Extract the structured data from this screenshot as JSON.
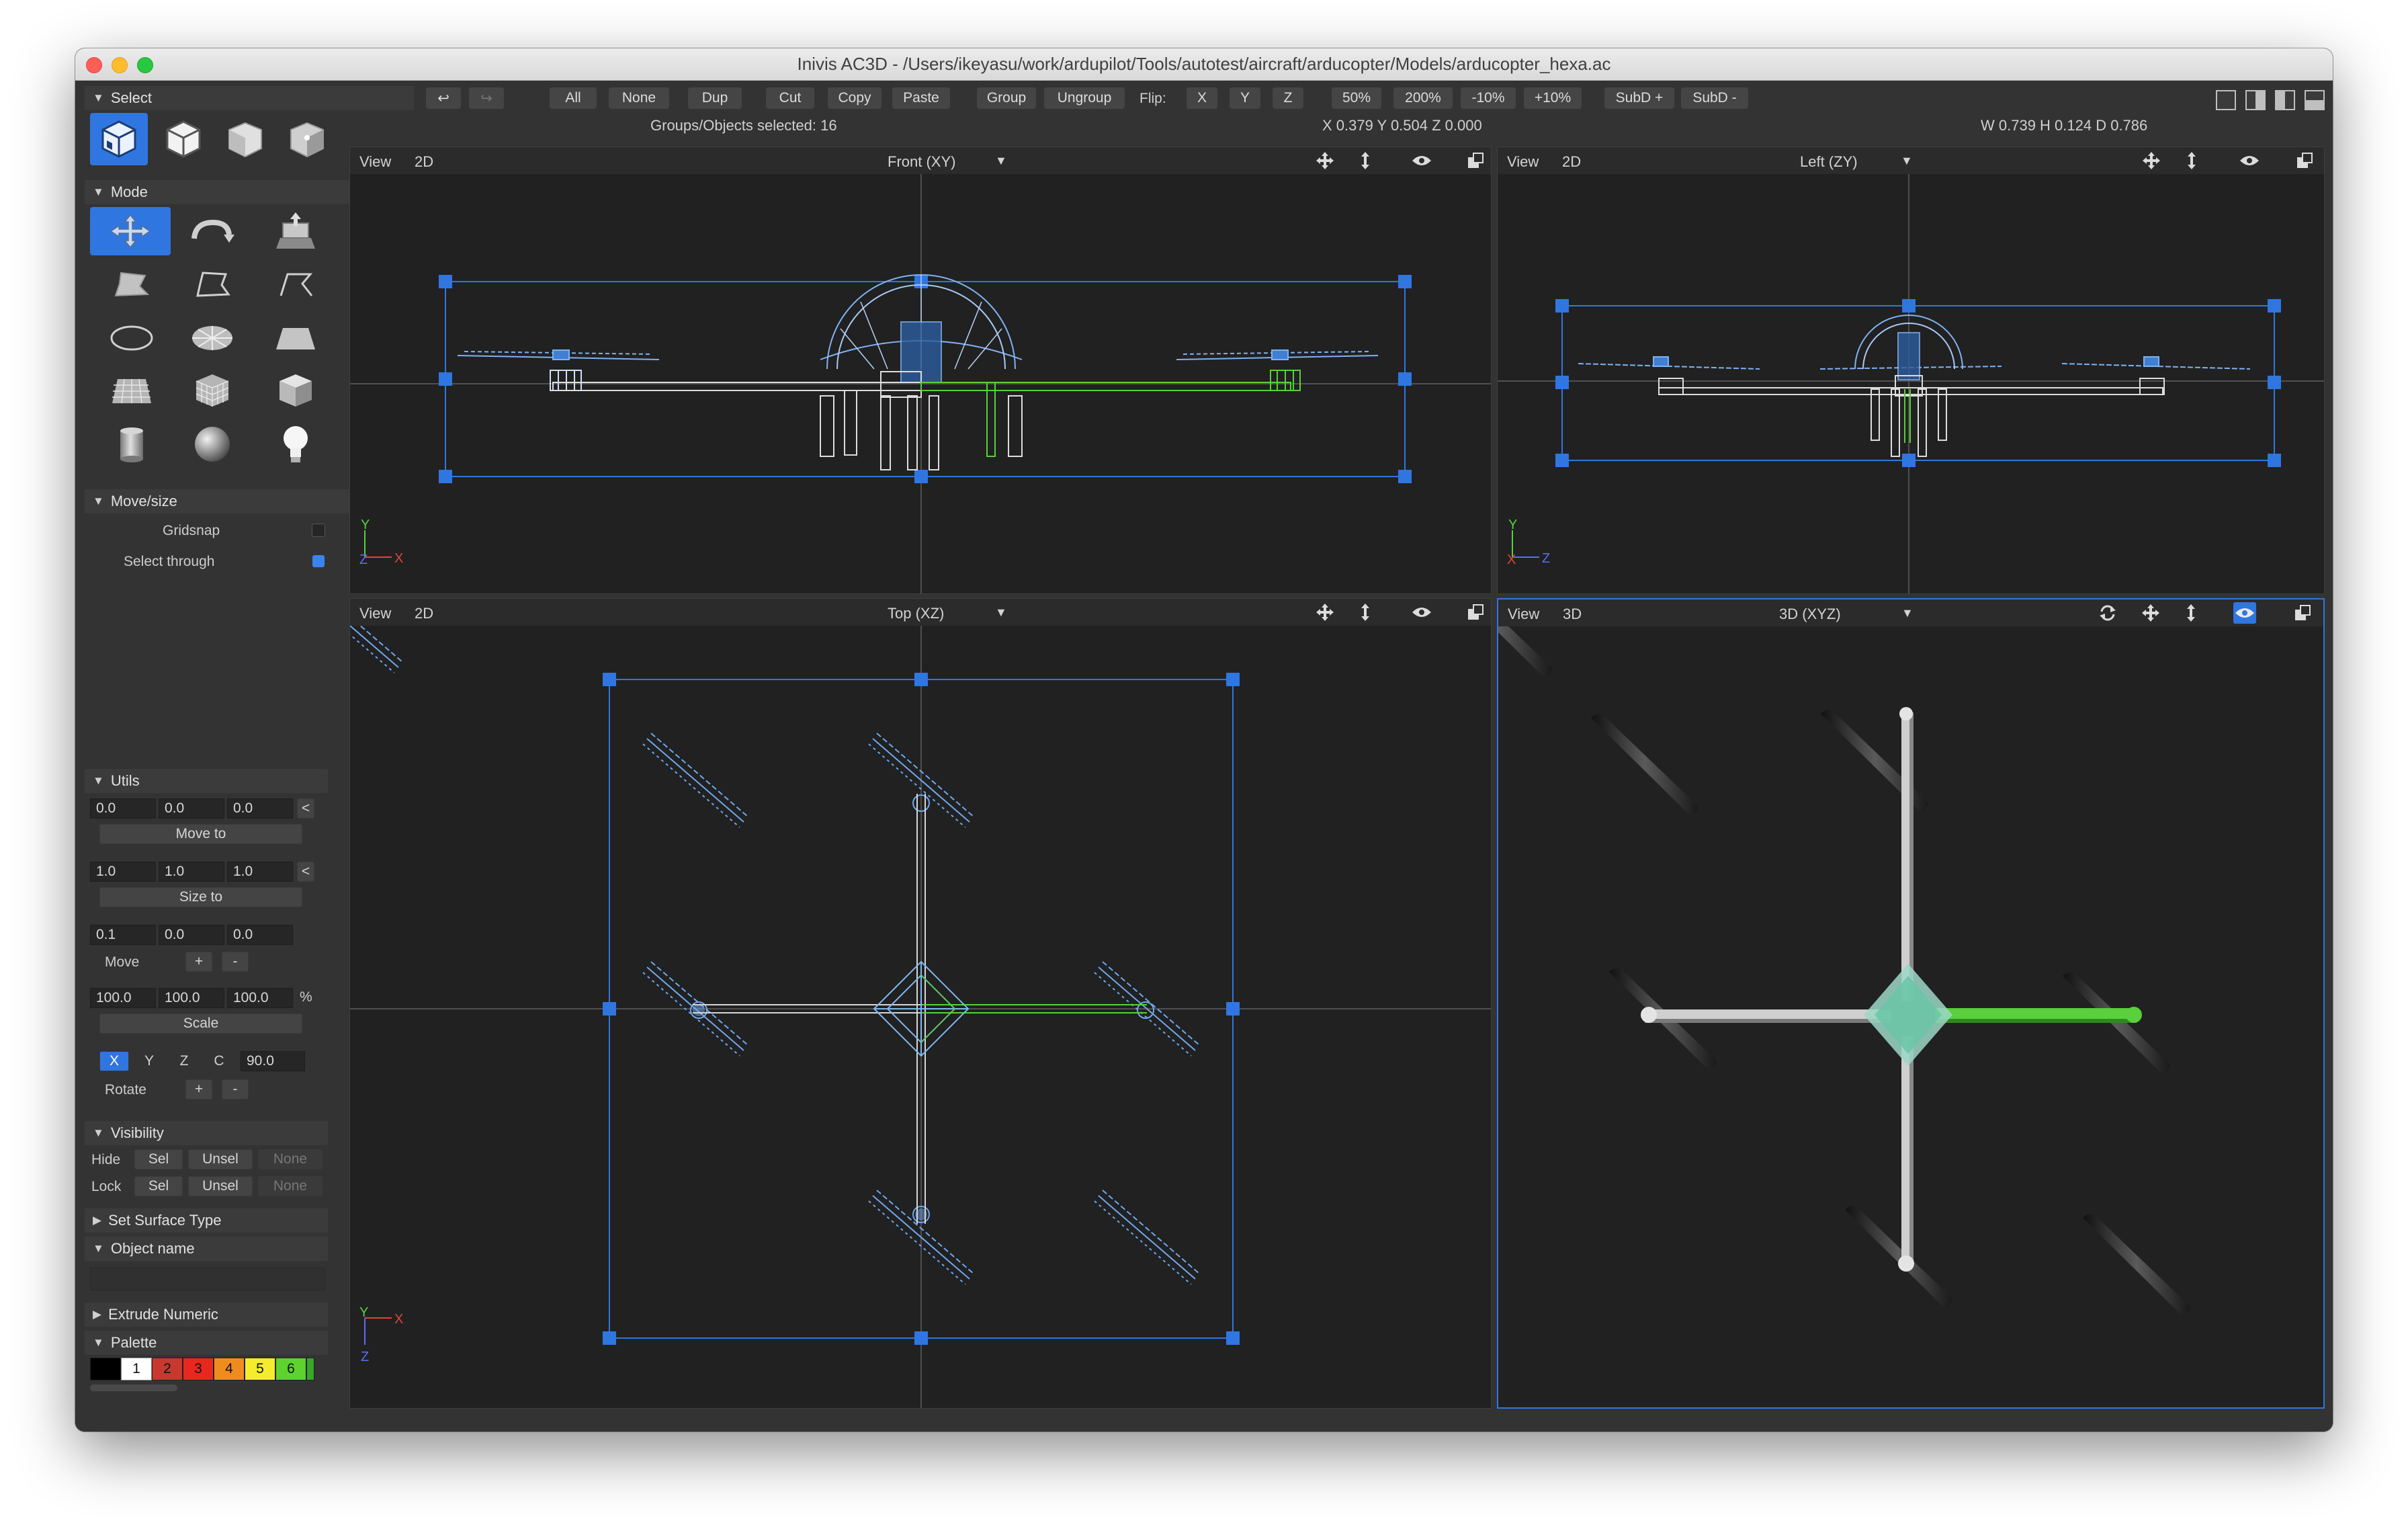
{
  "window": {
    "title": "Inivis AC3D - /Users/ikeyasu/work/ardupilot/Tools/autotest/aircraft/arducopter/Models/arducopter_hexa.ac"
  },
  "toolbar": {
    "undo": "↩",
    "redo": "↪",
    "all": "All",
    "none": "None",
    "dup": "Dup",
    "cut": "Cut",
    "copy": "Copy",
    "paste": "Paste",
    "group": "Group",
    "ungroup": "Ungroup",
    "flip_label": "Flip:",
    "flip_x": "X",
    "flip_y": "Y",
    "flip_z": "Z",
    "zoom_50": "50%",
    "zoom_200": "200%",
    "zoom_minus10": "-10%",
    "zoom_plus10": "+10%",
    "subd_plus": "SubD +",
    "subd_minus": "SubD -"
  },
  "status": {
    "selected": "Groups/Objects selected: 16",
    "position": "X 0.379 Y 0.504 Z 0.000",
    "dimensions": "W 0.739 H 0.124 D 0.786"
  },
  "sidebar": {
    "select": {
      "label": "Select"
    },
    "mode": {
      "label": "Mode"
    },
    "movesize": {
      "label": "Move/size",
      "gridsnap": "Gridsnap",
      "gridsnap_checked": false,
      "select_through": "Select through",
      "select_through_checked": true
    },
    "utils": {
      "label": "Utils",
      "move_to": {
        "x": "0.0",
        "y": "0.0",
        "z": "0.0",
        "button": "Move to",
        "arrow": "<"
      },
      "size_to": {
        "x": "1.0",
        "y": "1.0",
        "z": "1.0",
        "button": "Size to",
        "arrow": "<"
      },
      "move": {
        "x": "0.1",
        "y": "0.0",
        "z": "0.0",
        "label": "Move",
        "plus": "+",
        "minus": "-"
      },
      "scale": {
        "x": "100.0",
        "y": "100.0",
        "z": "100.0",
        "unit": "%",
        "button": "Scale"
      },
      "rotate": {
        "axis_x": "X",
        "axis_y": "Y",
        "axis_z": "Z",
        "axis_c": "C",
        "angle": "90.0",
        "label": "Rotate",
        "plus": "+",
        "minus": "-"
      }
    },
    "visibility": {
      "label": "Visibility",
      "hide": "Hide",
      "lock": "Lock",
      "sel": "Sel",
      "unsel": "Unsel",
      "none": "None"
    },
    "surface": {
      "label": "Set Surface Type"
    },
    "objname": {
      "label": "Object name",
      "value": ""
    },
    "extrude": {
      "label": "Extrude Numeric"
    },
    "palette": {
      "label": "Palette",
      "swatches": [
        {
          "label": "",
          "color": "#000000"
        },
        {
          "label": "1",
          "color": "#ffffff"
        },
        {
          "label": "2",
          "color": "#c8382e"
        },
        {
          "label": "3",
          "color": "#e8281e"
        },
        {
          "label": "4",
          "color": "#f08c1e"
        },
        {
          "label": "5",
          "color": "#f4ec2c"
        },
        {
          "label": "6",
          "color": "#5ed22e"
        },
        {
          "label": "",
          "color": "#35a82a"
        }
      ]
    }
  },
  "viewports": {
    "front": {
      "view": "View",
      "mode": "2D",
      "name": "Front (XY)",
      "axis_v": "Y",
      "axis_h": "X",
      "axis_o": "Z"
    },
    "left": {
      "view": "View",
      "mode": "2D",
      "name": "Left (ZY)",
      "axis_v": "Y",
      "axis_h": "Z",
      "axis_o": "X"
    },
    "top": {
      "view": "View",
      "mode": "2D",
      "name": "Top (XZ)",
      "axis_v": "Z",
      "axis_h": "X",
      "axis_o": "Y"
    },
    "persp": {
      "view": "View",
      "mode": "3D",
      "name": "3D (XYZ)"
    }
  },
  "colors": {
    "accent": "#2f76e0",
    "wire": "#6fa8ee",
    "selected_object": "#58d03a",
    "viewport_bg": "#212121"
  }
}
